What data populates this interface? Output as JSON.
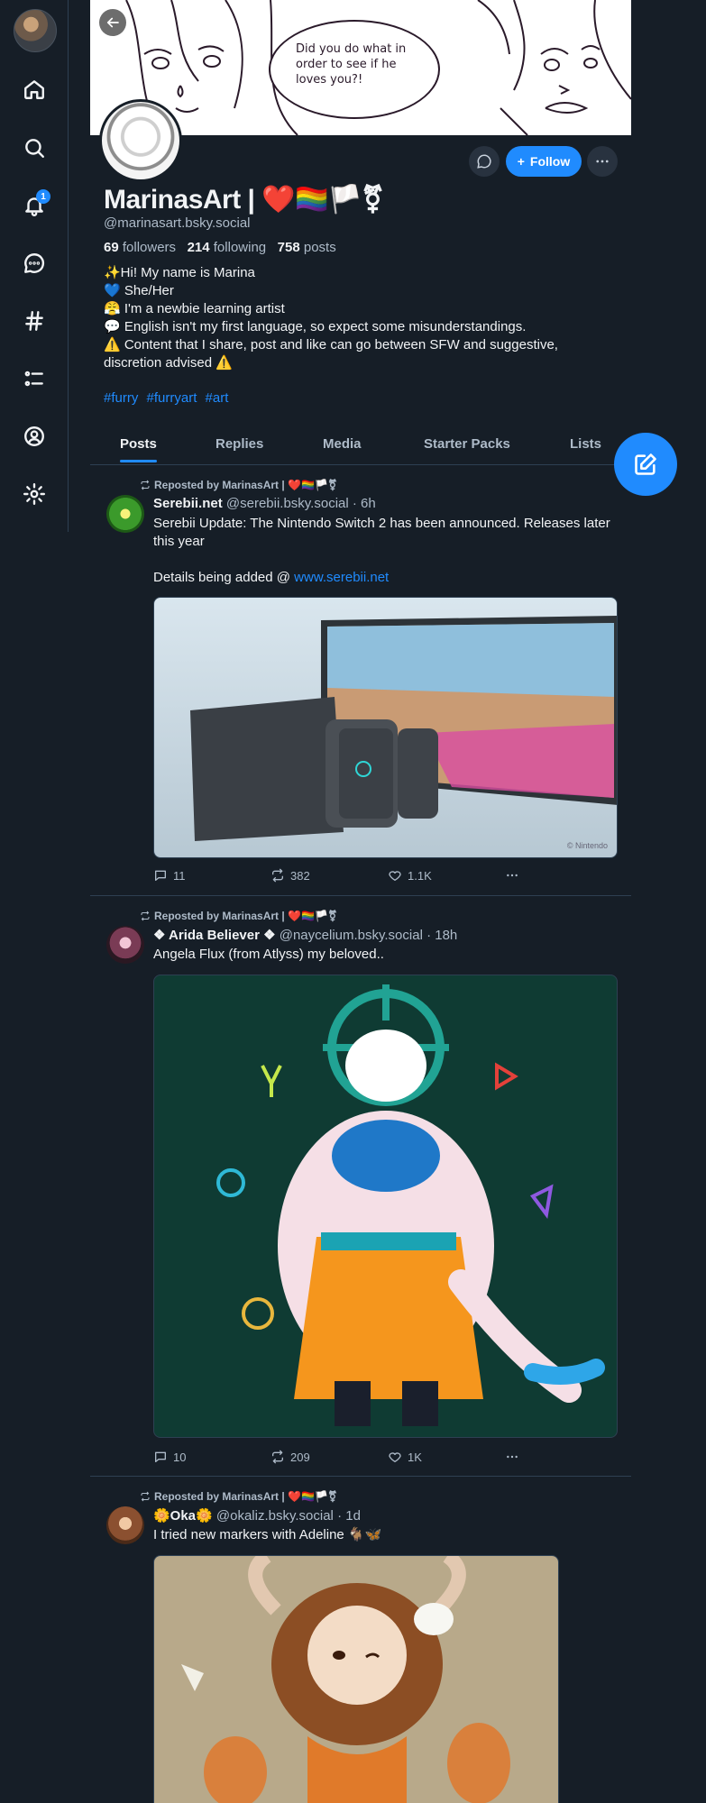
{
  "nav": {
    "notification_count": "1",
    "items": [
      "home",
      "search",
      "notifications",
      "chat",
      "feeds",
      "lists",
      "profile",
      "settings"
    ]
  },
  "banner": {
    "speech": "Did you do what in order to see if he loves you?!"
  },
  "profile": {
    "display_name": "MarinasArt | ❤️🏳️‍🌈🏳️⚧",
    "handle": "@marinasart.bsky.social",
    "followers_count": "69",
    "followers_label": "followers",
    "following_count": "214",
    "following_label": "following",
    "posts_count": "758",
    "posts_label": "posts",
    "follow_label": "Follow",
    "bio_lines": [
      "✨Hi! My name is Marina",
      "💙 She/Her",
      "😤 I'm a newbie learning artist",
      "💬 English isn't my first language, so expect some misunderstandings.",
      "⚠️ Content that I share, post and like can go between SFW and suggestive,",
      "discretion advised ⚠️"
    ],
    "hashtags": [
      "#furry",
      "#furryart",
      "#art"
    ]
  },
  "tabs": [
    "Posts",
    "Replies",
    "Media",
    "Starter Packs",
    "Lists"
  ],
  "posts": [
    {
      "repost_label": "Reposted by MarinasArt | ❤️🏳️‍🌈🏳️⚧",
      "author": "Serebii.net",
      "handle": "@serebii.bsky.social",
      "time": "· 6h",
      "text": "Serebii Update: The Nintendo Switch 2 has been announced. Releases later this year",
      "text2": "Details being added @ ",
      "link": "www.serebii.net",
      "image_caption": "© Nintendo",
      "replies": "11",
      "reposts": "382",
      "likes": "1.1K"
    },
    {
      "repost_label": "Reposted by MarinasArt | ❤️🏳️‍🌈🏳️⚧",
      "author": "❖ Arida Believer ❖",
      "handle": "@naycelium.bsky.social",
      "time": "· 18h",
      "text": "Angela Flux (from Atlyss) my beloved..",
      "replies": "10",
      "reposts": "209",
      "likes": "1K"
    },
    {
      "repost_label": "Reposted by MarinasArt | ❤️🏳️‍🌈🏳️⚧",
      "author": "🌼Oka🌼",
      "handle": "@okaliz.bsky.social",
      "time": "· 1d",
      "text": "I tried new markers with Adeline 🐐🦋"
    }
  ],
  "colors": {
    "accent": "#208bfe",
    "background": "#161e27",
    "muted": "#aebbc9",
    "border": "#2e4052"
  }
}
